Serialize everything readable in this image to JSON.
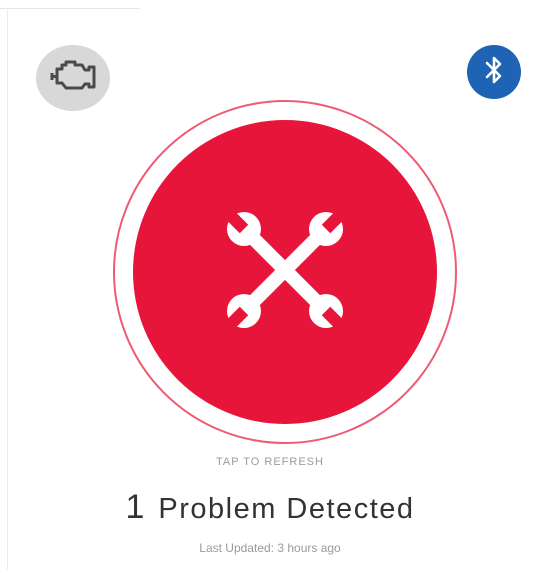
{
  "header": {
    "engine_icon": "check-engine-icon",
    "bluetooth_icon": "bluetooth-icon"
  },
  "status": {
    "icon": "crossed-wrenches-icon",
    "tap_label": "TAP TO REFRESH",
    "problem_count": "1",
    "problem_text": "Problem Detected",
    "last_updated": "Last Updated: 3 hours ago"
  },
  "colors": {
    "alert_red": "#e8153a",
    "ring": "#ef5a73",
    "bluetooth_blue": "#1f63b5",
    "engine_gray": "#d8d8d8"
  }
}
